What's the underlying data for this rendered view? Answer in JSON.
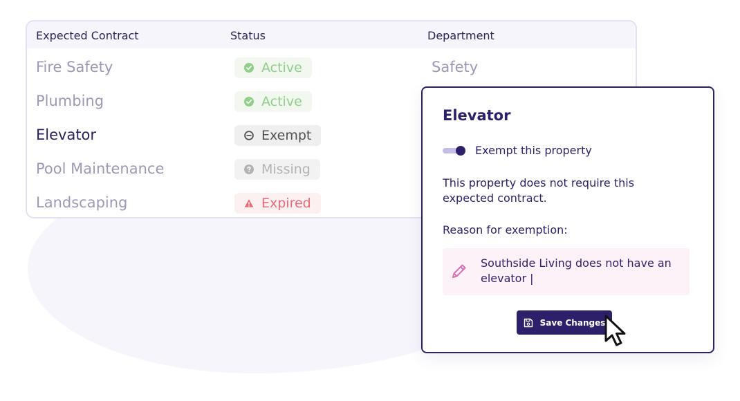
{
  "table": {
    "headers": {
      "contract": "Expected Contract",
      "status": "Status",
      "department": "Department"
    },
    "rows": [
      {
        "name": "Fire Safety",
        "status": "Active",
        "status_type": "active",
        "department": "Safety"
      },
      {
        "name": "Plumbing",
        "status": "Active",
        "status_type": "active",
        "department": ""
      },
      {
        "name": "Elevator",
        "status": "Exempt",
        "status_type": "exempt",
        "department": ""
      },
      {
        "name": "Pool Maintenance",
        "status": "Missing",
        "status_type": "missing",
        "department": ""
      },
      {
        "name": "Landscaping",
        "status": "Expired",
        "status_type": "expired",
        "department": ""
      }
    ]
  },
  "popover": {
    "title": "Elevator",
    "toggle_label": "Exempt this property",
    "toggle_on": true,
    "description": "This property does not require this expected contract.",
    "reason_label": "Reason for exemption:",
    "reason_value": "Southside Living does not have an elevator |",
    "save_label": "Save Changes"
  },
  "icons": {
    "active": "check-circle-icon",
    "exempt": "minus-circle-icon",
    "missing": "question-circle-icon",
    "expired": "warning-triangle-icon",
    "reason": "pencil-icon",
    "save": "floppy-disk-icon",
    "cursor": "mouse-pointer-icon"
  },
  "colors": {
    "brand": "#2e1f6a",
    "active": "#8fcf8a",
    "expired": "#e96a77",
    "missing": "#b3b3b3",
    "exempt": "#505050",
    "reason_bg": "#fdf2f8"
  }
}
